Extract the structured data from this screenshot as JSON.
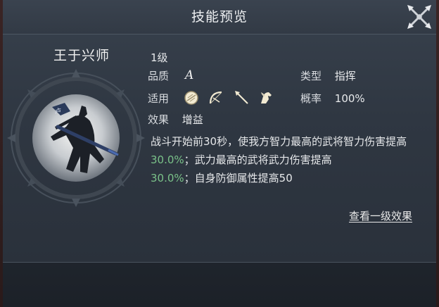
{
  "header": {
    "title": "技能预览"
  },
  "skill": {
    "name": "王于兴师",
    "level": "1级",
    "quality_label": "品质",
    "quality_value": "A",
    "type_label": "类型",
    "type_value": "指挥",
    "applicable_label": "适用",
    "applicable_icons": [
      "shield-icon",
      "bow-icon",
      "spear-icon",
      "horse-icon"
    ],
    "rate_label": "概率",
    "rate_value": "100%",
    "effect_label": "效果",
    "effect_value": "增益",
    "description": {
      "part1": "战斗开始前30秒，使我方智力最高的武将智力伤害提高",
      "value1": "30.0%",
      "part2": "；武力最高的武将武力伤害提高",
      "value2": "30.0%",
      "part3": "；自身防御属性提高50"
    },
    "view_level1_link": "查看一级效果"
  },
  "colors": {
    "highlight": "#7ac289",
    "panel": "#2f3742",
    "text": "#e6e8ea"
  }
}
